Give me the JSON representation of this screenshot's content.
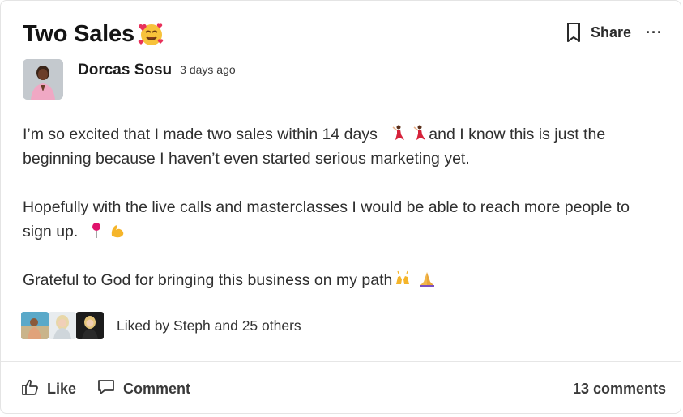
{
  "post": {
    "title": "Two Sales",
    "title_emoji": "smiling-face-with-hearts-icon",
    "author": "Dorcas Sosu",
    "timestamp": "3 days ago",
    "paragraphs": [
      {
        "text_a": "I’m so excited that I made two sales within 14 days",
        "text_b": "and I know this is just the beginning because I haven’t even started serious marketing yet."
      },
      {
        "text_a": "Hopefully with the live calls and masterclasses I would be able to reach more people to sign up."
      },
      {
        "text_a": "Grateful to God for bringing this business on my path"
      }
    ]
  },
  "actions": {
    "share_label": "Share",
    "more_label": "···"
  },
  "likes": {
    "text": "Liked by Steph and 25 others",
    "avatars": [
      "liker-avatar-1",
      "liker-avatar-2",
      "liker-avatar-3"
    ]
  },
  "footer": {
    "like_label": "Like",
    "comment_label": "Comment",
    "comments_count": "13 comments"
  },
  "colors": {
    "text": "#2f2f2f",
    "title": "#141414",
    "border": "#e4e4e4",
    "dancer_red": "#d6223a",
    "pin_pink": "#e0136c",
    "muscle_yellow": "#f5b52a"
  }
}
